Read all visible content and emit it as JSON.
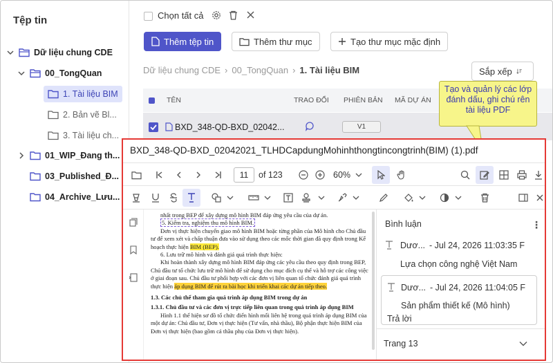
{
  "sidebar": {
    "title": "Tệp tin",
    "items": [
      {
        "label": "Dữ liệu chung CDE"
      },
      {
        "label": "00_TongQuan"
      },
      {
        "label": "1. Tài liệu BIM"
      },
      {
        "label": "2. Bản vẽ Bl..."
      },
      {
        "label": "3. Tài liệu ch..."
      },
      {
        "label": "01_WIP_Đang th..."
      },
      {
        "label": "03_Published_Đ..."
      },
      {
        "label": "04_Archive_Lưu..."
      }
    ]
  },
  "toolbar": {
    "select_all": "Chọn tất cả",
    "add_file": "Thêm tệp tin",
    "add_folder": "Thêm thư mục",
    "default_folder": "Tạo thư mục mặc định",
    "sort": "Sắp xếp"
  },
  "breadcrumb": [
    "Dữ liệu chung CDE",
    "00_TongQuan",
    "1. Tài liệu BIM"
  ],
  "table": {
    "columns": [
      "TÊN",
      "TRAO ĐỔI",
      "PHIÊN BẢN",
      "MÃ DỰ ÁN"
    ],
    "row": {
      "name": "BXD_348-QD-BXD_02042...",
      "version": "V1"
    }
  },
  "tooltip": "Tạo và quản lý các lớp đánh dấu, ghi chú rên tài liệu PDF",
  "viewer": {
    "title": "BXD_348-QD-BXD_02042021_TLHDCapdungMohinhthongtincongtrinh(BIM) (1).pdf",
    "page": "11",
    "page_total": "of 123",
    "zoom": "60%",
    "doc": {
      "l1": "nhất trong BEP để xây dựng mô hình BIM đáp ứng yêu cầu của dự án.",
      "l2": "5. Kiểm tra, nghiệm thu mô hình BIM.",
      "l3": "Đơn vị thực hiện chuyển giao mô hình BIM hoặc từng phần của Mô hình cho Chủ đầu tư để xem xét và chấp thuận đưa vào sử dụng theo các mốc thời gian đã quy định trong Kế hoạch thực hiện",
      "l3h": "BIM (BEP).",
      "l4": "6. Lưu trữ mô hình và đánh giá quá trình thực hiện:",
      "l5": "Khi hoàn thành xây dựng mô hình BIM đáp ứng các yêu cầu theo quy định trong BEP, Chủ đầu tư tổ chức lưu trữ mô hình để sử dụng cho mục đích cụ thể và hỗ trợ các công việc ở giai đoạn sau. Chủ đầu tư phối hợp với các đơn vị liên quan tổ chức đánh giá quá trình thực hiện",
      "l5h": "áp dụng BIM để rút ra bài học khi triển khai các dự án tiếp theo.",
      "h1": "1.3. Các chủ thể tham gia quá trình áp dụng BIM trong dự án",
      "h2": "1.3.1. Chủ đầu tư và các đơn vị trực tiếp liên quan trong quá trình áp dụng BIM",
      "l6": "Hình 1.1 thể hiện sơ đồ tổ chức điển hình mối liên hệ trong quá trình áp dụng BIM của một dự án: Chủ đầu tư, Đơn vị thực hiện (Tư vấn, nhà thầu), Bộ phận thực hiện BIM của Đơn vị thực hiện (bao gồm cả thầu phụ của Đơn vị thực hiện)."
    }
  },
  "comments": {
    "title": "Bình luận",
    "items": [
      {
        "author": "Dươ...",
        "date": "- Jul 24, 2026 11:03:35 F",
        "text": "Lựa chọn công nghệ Việt Nam"
      },
      {
        "author": "Dươ...",
        "date": "- Jul 24, 2026 11:04:05 F",
        "text": "Sản phẩm thiết kế (Mô hình)",
        "reply": "Trả lời"
      }
    ],
    "page_section": "Trang 13"
  }
}
